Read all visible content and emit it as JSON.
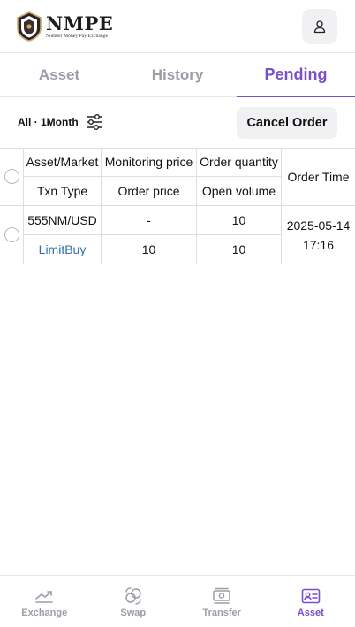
{
  "header": {
    "logo_title": "NMPE",
    "logo_subtitle": "Number Money Pay Exchange",
    "user_icon": "user-icon"
  },
  "tabs": [
    {
      "label": "Asset",
      "active": false
    },
    {
      "label": "History",
      "active": false
    },
    {
      "label": "Pending",
      "active": true
    }
  ],
  "filter": {
    "label": "All · 1Month",
    "icon": "sliders-icon"
  },
  "cancel_button": "Cancel Order",
  "table": {
    "headers": {
      "asset_market": "Asset/Market",
      "monitoring_price": "Monitoring price",
      "order_quantity": "Order quantity",
      "order_time": "Order Time",
      "txn_type": "Txn Type",
      "order_price": "Order price",
      "open_volume": "Open volume"
    },
    "rows": [
      {
        "asset_market": "555NM/USD",
        "monitoring_price": "-",
        "order_quantity": "10",
        "txn_type": "LimitBuy",
        "order_price": "10",
        "open_volume": "10",
        "order_date": "2025-05-14",
        "order_clock": "17:16"
      }
    ]
  },
  "bottom_nav": [
    {
      "label": "Exchange",
      "icon": "chart-trend-icon",
      "active": false
    },
    {
      "label": "Swap",
      "icon": "swap-coins-icon",
      "active": false
    },
    {
      "label": "Transfer",
      "icon": "cash-icon",
      "active": false
    },
    {
      "label": "Asset",
      "icon": "id-card-icon",
      "active": true
    }
  ],
  "colors": {
    "accent": "#7a4fc9",
    "link": "#2b6fb5",
    "muted": "#9a9ea6"
  }
}
